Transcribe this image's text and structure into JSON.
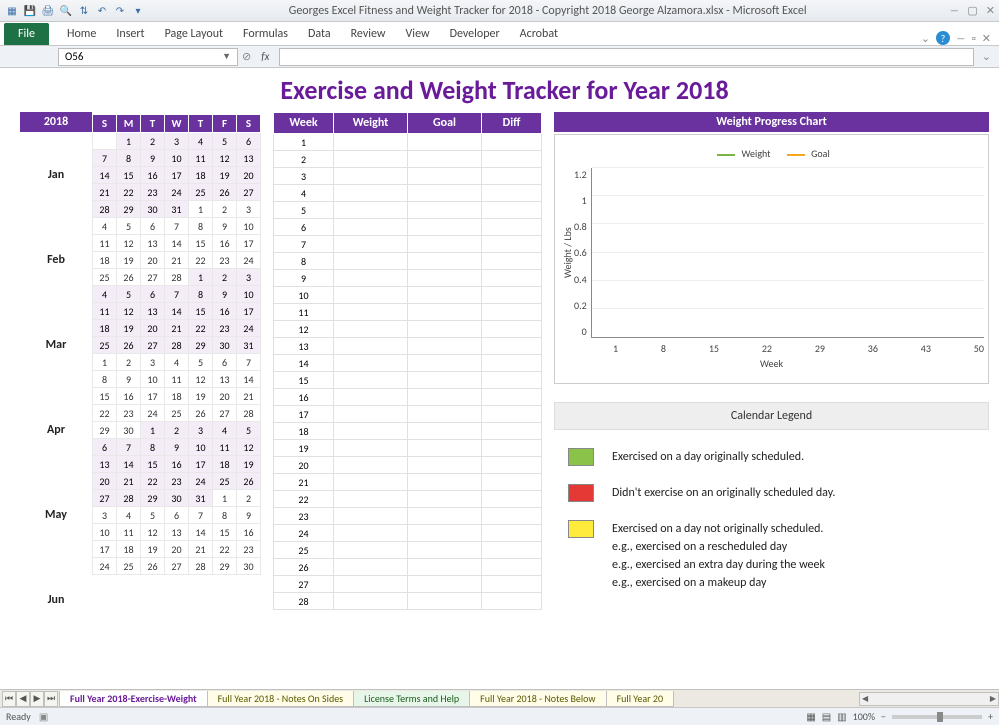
{
  "window": {
    "title": "Georges Excel Fitness and Weight Tracker for 2018 - Copyright 2018 George Alzamora.xlsx - Microsoft Excel",
    "qat": [
      "save",
      "undo",
      "redo",
      "more"
    ]
  },
  "ribbon": {
    "file": "File",
    "tabs": [
      "Home",
      "Insert",
      "Page Layout",
      "Formulas",
      "Data",
      "Review",
      "View",
      "Developer",
      "Acrobat"
    ]
  },
  "namebox": {
    "ref": "O56",
    "fx": "fx"
  },
  "sheet": {
    "title": "Exercise and Weight Tracker for Year 2018",
    "year": "2018",
    "dow": [
      "S",
      "M",
      "T",
      "W",
      "T",
      "F",
      "S"
    ],
    "months": [
      "Jan",
      "Feb",
      "Mar",
      "Apr",
      "May",
      "Jun"
    ],
    "week_headers": [
      "Week",
      "Weight",
      "Goal",
      "Diff"
    ],
    "weeks": [
      1,
      2,
      3,
      4,
      5,
      6,
      7,
      8,
      9,
      10,
      11,
      12,
      13,
      14,
      15,
      16,
      17,
      18,
      19,
      20,
      21,
      22,
      23,
      24,
      25,
      26,
      27,
      28
    ]
  },
  "chart_data": {
    "type": "line",
    "title": "Weight Progress Chart",
    "series": [
      {
        "name": "Weight",
        "color": "#7cb342",
        "values": []
      },
      {
        "name": "Goal",
        "color": "#f5a623",
        "values": []
      }
    ],
    "x": [
      1,
      8,
      15,
      22,
      29,
      36,
      43,
      50
    ],
    "xlabel": "Week",
    "ylabel": "Weight / Lbs",
    "yticks": [
      0,
      0.2,
      0.4,
      0.6,
      0.8,
      1,
      1.2
    ],
    "ylim": [
      0,
      1.2
    ]
  },
  "legend": {
    "title": "Calendar Legend",
    "items": [
      {
        "color": "#8bc34a",
        "text": "Exercised on a day originally scheduled."
      },
      {
        "color": "#e53935",
        "text": "Didn't exercise on an originally scheduled day."
      },
      {
        "color": "#ffeb3b",
        "text": "Exercised on a day not originally scheduled.\ne.g., exercised on a rescheduled day\ne.g., exercised an extra day during the week\ne.g., exercised on a makeup day"
      }
    ]
  },
  "tabs": {
    "items": [
      {
        "label": "Full Year 2018-Exercise-Weight",
        "active": true,
        "cls": ""
      },
      {
        "label": "Full Year 2018 - Notes On Sides",
        "active": false,
        "cls": ""
      },
      {
        "label": "License Terms and Help",
        "active": false,
        "cls": "green"
      },
      {
        "label": "Full Year 2018 - Notes Below",
        "active": false,
        "cls": ""
      },
      {
        "label": "Full Year 20",
        "active": false,
        "cls": ""
      }
    ]
  },
  "status": {
    "ready": "Ready",
    "zoom": "100%"
  },
  "calendar": [
    {
      "month": "Jan",
      "offset": 1,
      "days": 31
    },
    {
      "month": "Feb",
      "offset": 4,
      "days": 28
    },
    {
      "month": "Mar",
      "offset": 4,
      "days": 31
    },
    {
      "month": "Apr",
      "offset": 0,
      "days": 30
    },
    {
      "month": "May",
      "offset": 2,
      "days": 31
    },
    {
      "month": "Jun",
      "offset": 5,
      "days": 30
    }
  ]
}
